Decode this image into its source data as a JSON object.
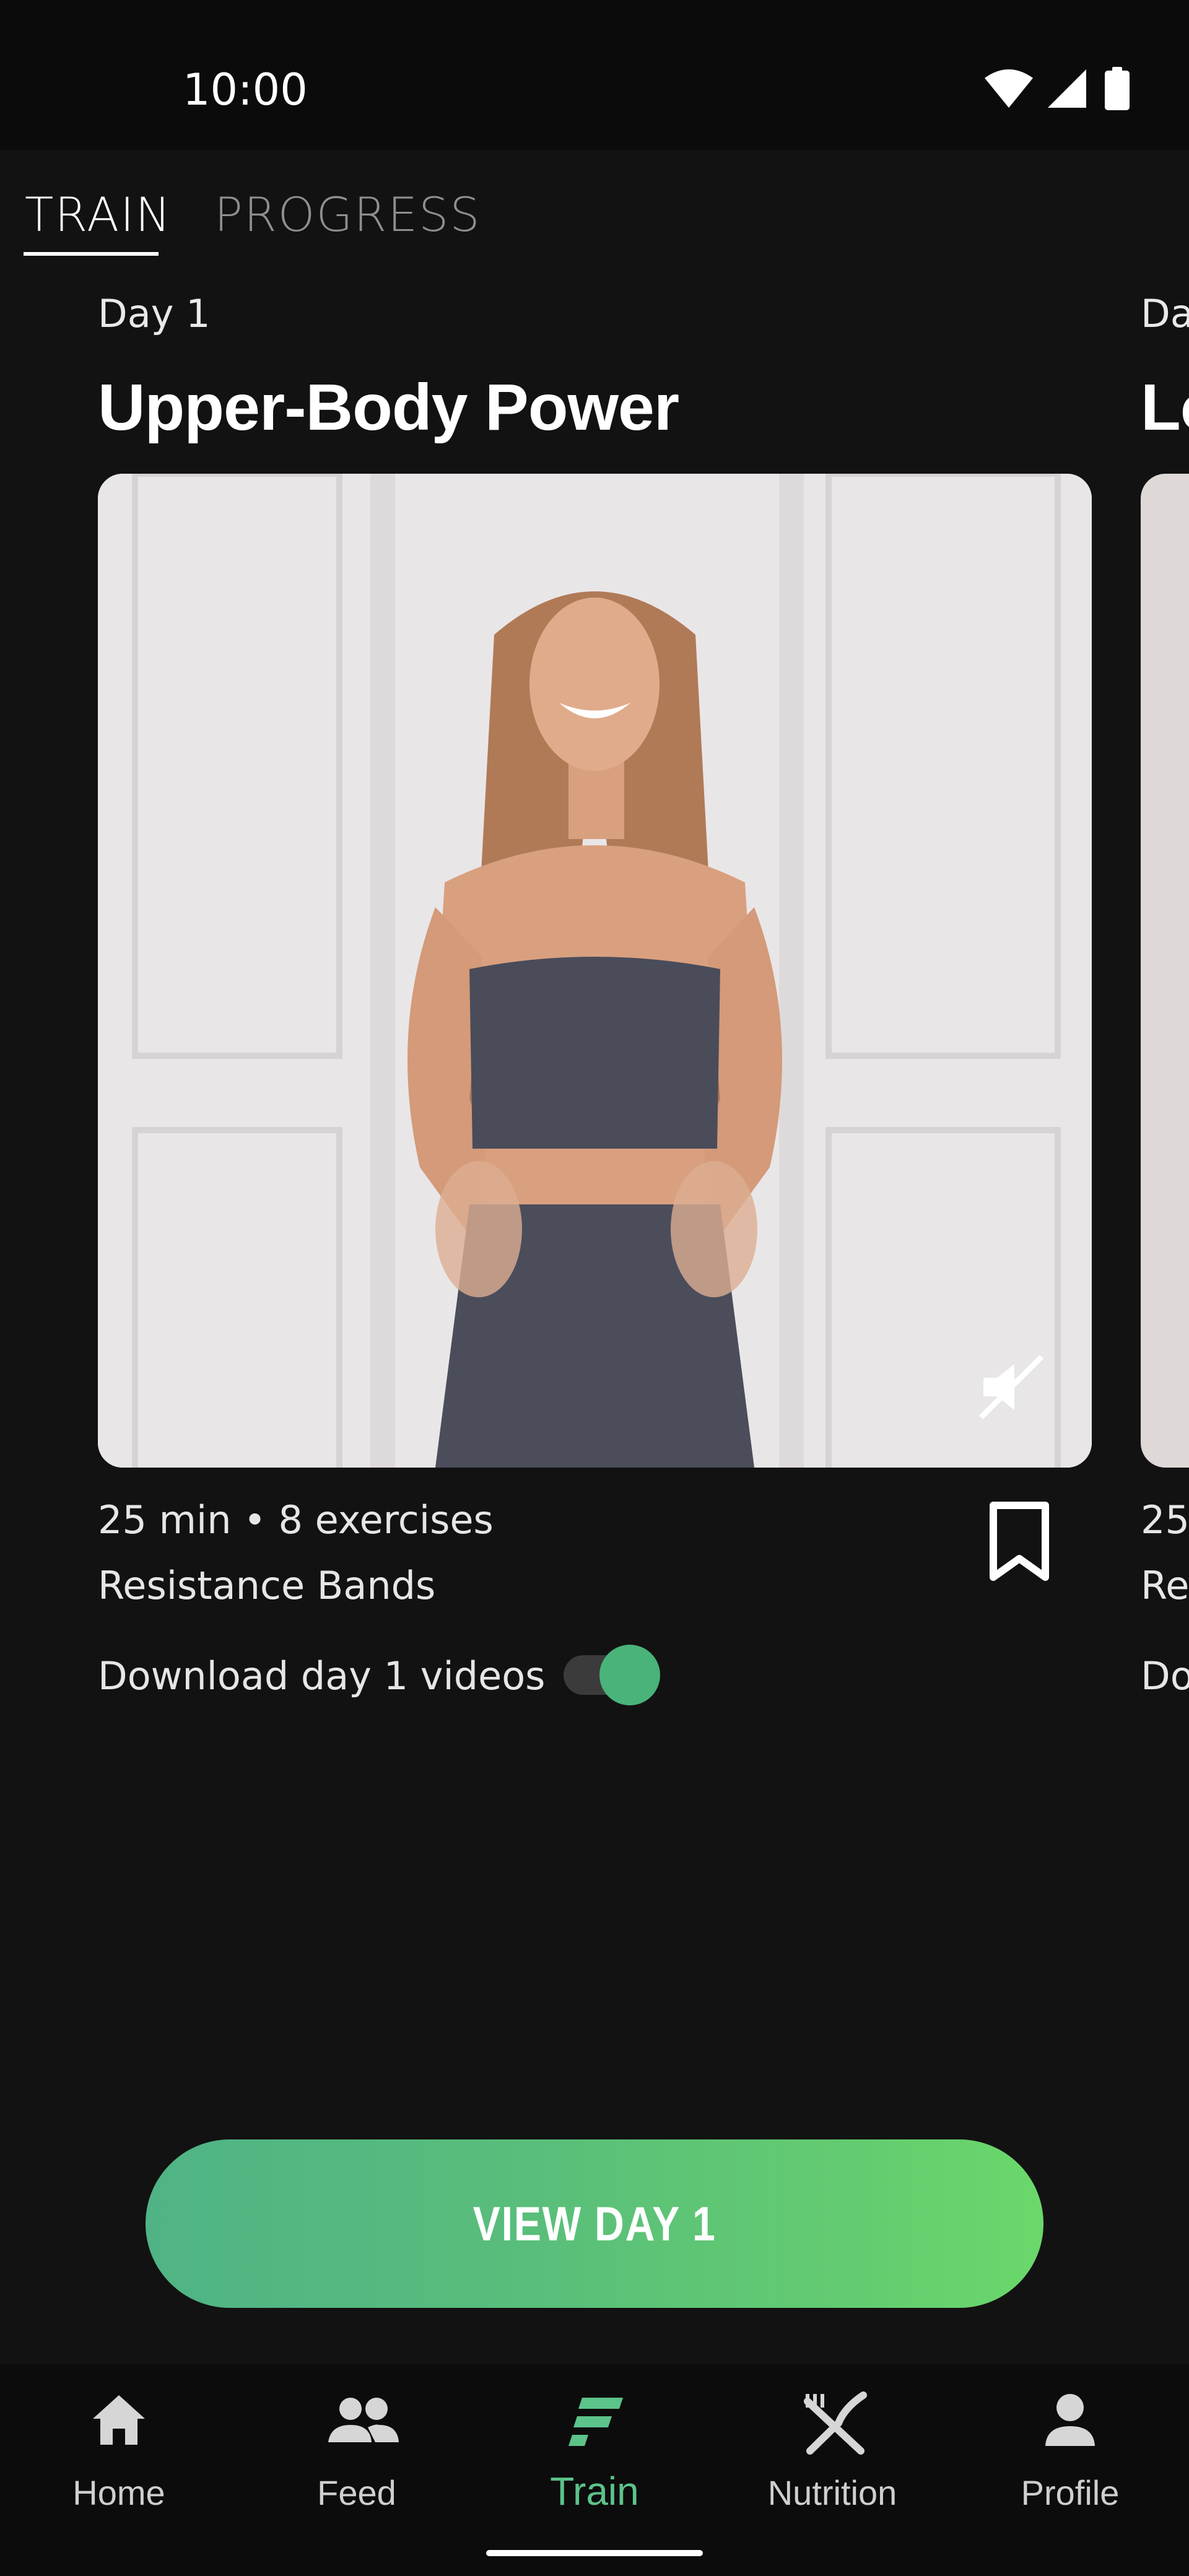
{
  "status_bar": {
    "time": "10:00",
    "icons": [
      "wifi-icon",
      "signal-icon",
      "battery-icon"
    ]
  },
  "tabs": [
    {
      "label": "TRAIN",
      "active": true
    },
    {
      "label": "PROGRESS",
      "active": false
    }
  ],
  "cards": [
    {
      "day": "Day 1",
      "title": "Upper-Body Power",
      "duration_exercises": "25 min • 8 exercises",
      "equipment": "Resistance Bands",
      "download_label": "Download day 1 videos",
      "download_enabled": true,
      "muted": true
    },
    {
      "day": "Da",
      "title": "Lo",
      "duration_exercises": "25",
      "equipment": "Re",
      "download_label": "Do"
    }
  ],
  "cta": {
    "label": "VIEW DAY 1"
  },
  "bottom_nav": [
    {
      "label": "Home",
      "icon": "home-icon",
      "active": false
    },
    {
      "label": "Feed",
      "icon": "people-icon",
      "active": false
    },
    {
      "label": "Train",
      "icon": "train-icon",
      "active": true
    },
    {
      "label": "Nutrition",
      "icon": "utensils-icon",
      "active": false
    },
    {
      "label": "Profile",
      "icon": "person-icon",
      "active": false
    }
  ],
  "colors": {
    "accent": "#5cc38a",
    "background": "#121212",
    "cta_gradient_start": "#4fb386",
    "cta_gradient_end": "#6ad86b"
  }
}
